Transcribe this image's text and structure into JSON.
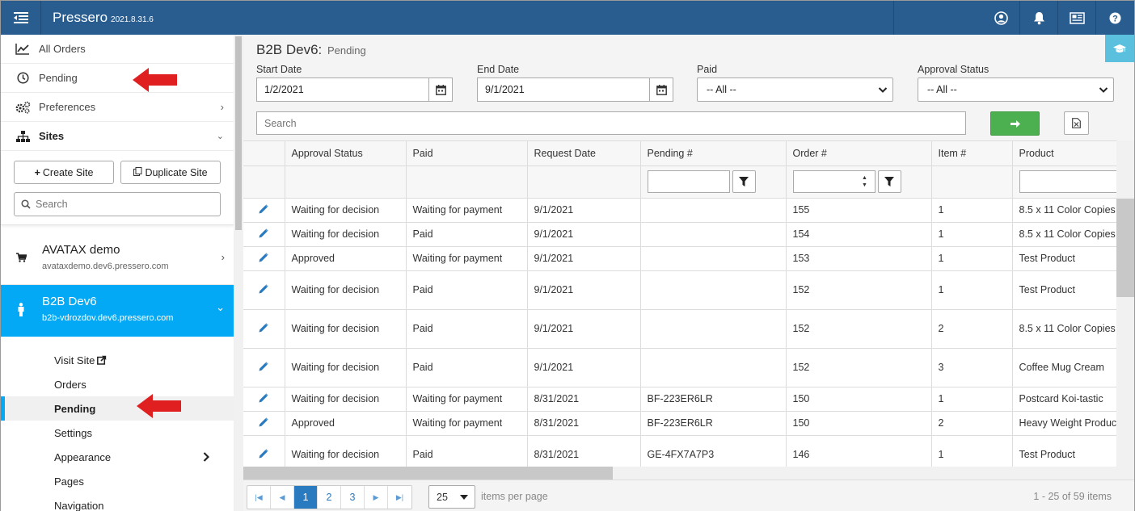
{
  "header": {
    "brand": "Pressero",
    "version": "2021.8.31.6",
    "icons": [
      "user-circle-icon",
      "bell-icon",
      "news-icon",
      "help-icon"
    ]
  },
  "sidebar": {
    "nav": [
      {
        "label": "All Orders",
        "icon": "chart-line-icon"
      },
      {
        "label": "Pending",
        "icon": "clock-icon"
      },
      {
        "label": "Preferences",
        "icon": "cogs-icon"
      },
      {
        "label": "Sites",
        "icon": "sitemap-icon"
      }
    ],
    "create_site": "Create Site",
    "duplicate_site": "Duplicate Site",
    "search_placeholder": "Search",
    "sites": [
      {
        "name": "AVATAX demo",
        "url": "avataxdemo.dev6.pressero.com"
      },
      {
        "name": "B2B Dev6",
        "url": "b2b-vdrozdov.dev6.pressero.com"
      }
    ],
    "sub_items": [
      "Visit Site",
      "Orders",
      "Pending",
      "Settings",
      "Appearance",
      "Pages",
      "Navigation"
    ]
  },
  "main": {
    "title": "B2B Dev6:",
    "subtitle": "Pending",
    "filters": {
      "start_label": "Start Date",
      "start_value": "1/2/2021",
      "end_label": "End Date",
      "end_value": "9/1/2021",
      "paid_label": "Paid",
      "paid_value": "-- All --",
      "approval_label": "Approval Status",
      "approval_value": "-- All --"
    },
    "search_placeholder": "Search"
  },
  "table": {
    "columns": [
      "Approval Status",
      "Paid",
      "Request Date",
      "Pending #",
      "Order #",
      "Item #",
      "Product"
    ],
    "rows": [
      {
        "status": "Waiting for decision",
        "paid": "Waiting for payment",
        "date": "9/1/2021",
        "pending": "",
        "order": "155",
        "item": "1",
        "product": "8.5 x 11 Color Copies"
      },
      {
        "status": "Waiting for decision",
        "paid": "Paid",
        "date": "9/1/2021",
        "pending": "",
        "order": "154",
        "item": "1",
        "product": "8.5 x 11 Color Copies"
      },
      {
        "status": "Approved",
        "paid": "Waiting for payment",
        "date": "9/1/2021",
        "pending": "",
        "order": "153",
        "item": "1",
        "product": "Test Product"
      },
      {
        "status": "Waiting for decision",
        "paid": "Paid",
        "date": "9/1/2021",
        "pending": "",
        "order": "152",
        "item": "1",
        "product": "Test Product"
      },
      {
        "status": "Waiting for decision",
        "paid": "Paid",
        "date": "9/1/2021",
        "pending": "",
        "order": "152",
        "item": "2",
        "product": "8.5 x 11 Color Copies"
      },
      {
        "status": "Waiting for decision",
        "paid": "Paid",
        "date": "9/1/2021",
        "pending": "",
        "order": "152",
        "item": "3",
        "product": "Coffee Mug Cream"
      },
      {
        "status": "Waiting for decision",
        "paid": "Waiting for payment",
        "date": "8/31/2021",
        "pending": "BF-223ER6LR",
        "order": "150",
        "item": "1",
        "product": "Postcard Koi-tastic"
      },
      {
        "status": "Approved",
        "paid": "Waiting for payment",
        "date": "8/31/2021",
        "pending": "BF-223ER6LR",
        "order": "150",
        "item": "2",
        "product": "Heavy Weight Product"
      },
      {
        "status": "Waiting for decision",
        "paid": "Paid",
        "date": "8/31/2021",
        "pending": "GE-4FX7A7P3",
        "order": "146",
        "item": "1",
        "product": "Test Product"
      }
    ]
  },
  "pager": {
    "pages": [
      "1",
      "2",
      "3"
    ],
    "current": "1",
    "per_page": "25",
    "per_page_label": "items per page",
    "range": "1 - 25 of 59 items"
  },
  "colors": {
    "header_bg": "#2a5d8f",
    "active_site": "#03a9f4",
    "go_button": "#4caf50",
    "pencil": "#2a7ac0",
    "arrow": "#e02020"
  }
}
